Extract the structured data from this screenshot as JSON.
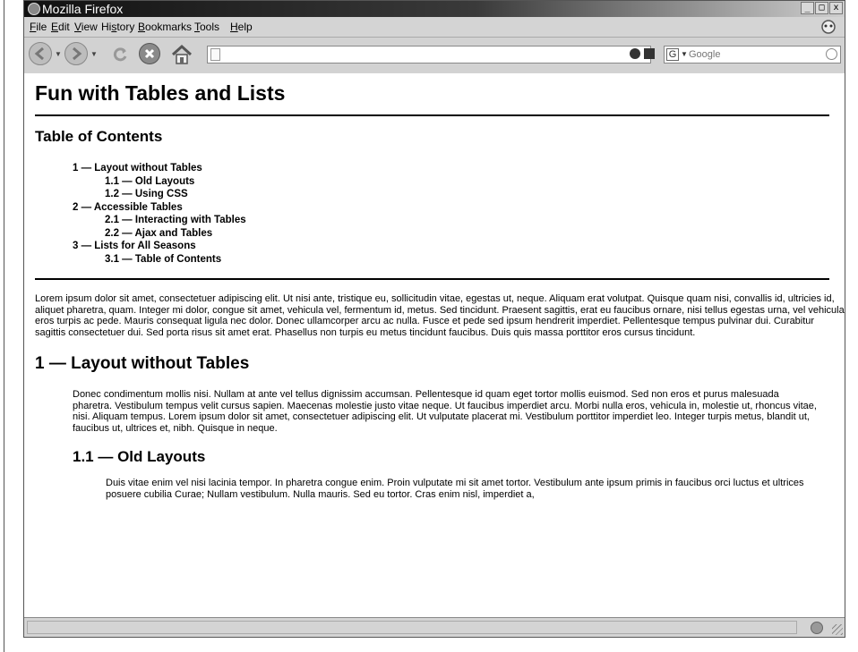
{
  "window": {
    "title": "Mozilla Firefox"
  },
  "window_controls": {
    "minimize": "_",
    "maximize": "□",
    "close": "x"
  },
  "menu": [
    {
      "pre": "",
      "key": "F",
      "post": "ile"
    },
    {
      "pre": "",
      "key": "E",
      "post": "dit"
    },
    {
      "pre": "",
      "key": "V",
      "post": "iew"
    },
    {
      "pre": "Hi",
      "key": "s",
      "post": "tory"
    },
    {
      "pre": "",
      "key": "B",
      "post": "ookmarks"
    },
    {
      "pre": "",
      "key": "T",
      "post": "ools"
    },
    {
      "pre": "",
      "key": "H",
      "post": "elp"
    }
  ],
  "navbar": {
    "url_value": "",
    "search_engine_letter": "G",
    "search_placeholder": "Google",
    "icons": [
      "back-icon",
      "forward-icon",
      "reload-icon",
      "stop-icon",
      "home-icon"
    ]
  },
  "page": {
    "title": "Fun with Tables and Lists",
    "toc_title": "Table of Contents",
    "toc": [
      {
        "label": "1 — Layout without Tables",
        "level": 1
      },
      {
        "label": "1.1 — Old Layouts",
        "level": 2
      },
      {
        "label": "1.2 — Using CSS",
        "level": 2
      },
      {
        "label": "2 — Accessible Tables",
        "level": 1
      },
      {
        "label": "2.1 — Interacting with Tables",
        "level": 2
      },
      {
        "label": "2.2 — Ajax and Tables",
        "level": 2
      },
      {
        "label": "3 — Lists for All Seasons",
        "level": 1
      },
      {
        "label": "3.1 — Table of Contents",
        "level": 2
      }
    ],
    "intro": "Lorem ipsum dolor sit amet, consectetuer adipiscing elit. Ut nisi ante, tristique eu, sollicitudin vitae, egestas ut, neque. Aliquam erat volutpat. Quisque quam nisi, convallis id, ultricies id, aliquet pharetra, quam. Integer mi dolor, congue sit amet, vehicula vel, fermentum id, metus. Sed tincidunt. Praesent sagittis, erat eu faucibus ornare, nisi tellus egestas urna, vel vehicula eros turpis ac pede. Mauris consequat ligula nec dolor. Donec ullamcorper arcu ac nulla. Fusce et pede sed ipsum hendrerit imperdiet. Pellentesque tempus pulvinar dui. Curabitur sagittis consectetuer dui. Sed porta risus sit amet erat. Phasellus non turpis eu metus tincidunt faucibus. Duis quis massa porttitor eros cursus tincidunt.",
    "section1_title": "1 — Layout without Tables",
    "section1_text": "Donec condimentum mollis nisi. Nullam at ante vel tellus dignissim accumsan. Pellentesque id quam eget tortor mollis euismod. Sed non eros et purus malesuada pharetra. Vestibulum tempus velit cursus sapien. Maecenas molestie justo vitae neque. Ut faucibus imperdiet arcu. Morbi nulla eros, vehicula in, molestie ut, rhoncus vitae, nisi. Aliquam tempus. Lorem ipsum dolor sit amet, consectetuer adipiscing elit. Ut vulputate placerat mi. Vestibulum porttitor imperdiet leo. Integer turpis metus, blandit ut, faucibus ut, ultrices et, nibh. Quisque in neque.",
    "section11_title": "1.1 — Old Layouts",
    "section11_text": "Duis vitae enim vel nisi lacinia tempor. In pharetra congue enim. Proin vulputate mi sit amet tortor. Vestibulum ante ipsum primis in faucibus orci luctus et ultrices posuere cubilia Curae; Nullam vestibulum. Nulla mauris. Sed eu tortor. Cras enim nisl, imperdiet a,"
  }
}
